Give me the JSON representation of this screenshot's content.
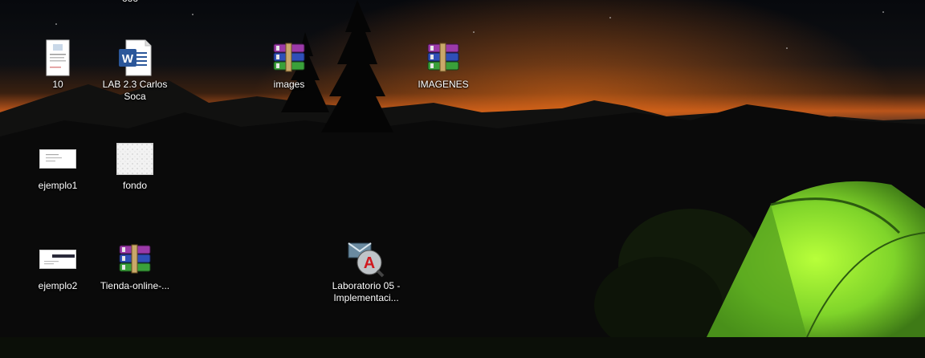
{
  "desktop": {
    "top_partial_label": "ooo",
    "icons": [
      {
        "label": "10",
        "kind": "document-thumb-icon"
      },
      {
        "label": "LAB 2.3 Carlos\nSoca",
        "kind": "word-document-icon"
      },
      {
        "label": "images",
        "kind": "winrar-archive-icon"
      },
      {
        "label": "IMAGENES",
        "kind": "winrar-archive-icon"
      },
      {
        "label": "ejemplo1",
        "kind": "image-thumb-icon"
      },
      {
        "label": "fondo",
        "kind": "image-thumb-icon"
      },
      {
        "label": "ejemplo2",
        "kind": "image-thumb-icon"
      },
      {
        "label": "Tienda-online-...",
        "kind": "winrar-archive-icon"
      },
      {
        "label": "Laboratorio 05 -\nImplementaci...",
        "kind": "autocad-file-icon"
      }
    ]
  },
  "colors": {
    "sky_glow": "#c85a18",
    "tent_green": "#8fe32a",
    "word_blue": "#2b579a",
    "autocad_red": "#d0181f"
  }
}
